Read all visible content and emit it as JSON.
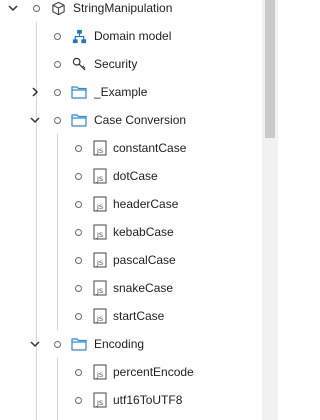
{
  "tree": {
    "root": {
      "label": "StringManipulation",
      "icon": "cube-icon",
      "expanded": true
    },
    "items": [
      {
        "label": "Domain model",
        "icon": "hierarchy-icon"
      },
      {
        "label": "Security",
        "icon": "key-icon"
      },
      {
        "label": "_Example",
        "icon": "folder-icon",
        "expanded": false
      },
      {
        "label": "Case Conversion",
        "icon": "folder-icon",
        "expanded": true,
        "children": [
          "constantCase",
          "dotCase",
          "headerCase",
          "kebabCase",
          "pascalCase",
          "snakeCase",
          "startCase"
        ]
      },
      {
        "label": "Encoding",
        "icon": "folder-icon",
        "expanded": true,
        "children": [
          "percentEncode",
          "utf16ToUTF8"
        ]
      }
    ],
    "js_badge": "JS"
  },
  "colors": {
    "folder": "#2a8ad4",
    "hierarchy": "#1c73c7",
    "guide": "#d6d6d6"
  }
}
